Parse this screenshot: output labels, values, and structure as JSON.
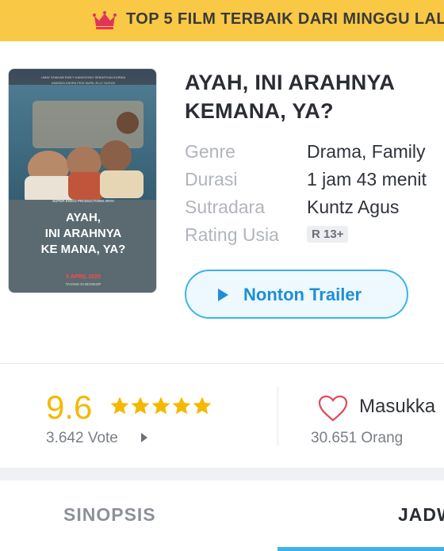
{
  "banner": {
    "text": "TOP 5 FILM TERBAIK DARI MINGGU LAL",
    "icon": "crown-icon"
  },
  "movie": {
    "title": "AYAH, INI ARAHNYA KEMANA, YA?",
    "poster": {
      "credits_line": "UMAY SHAHAB   RIZKY HANGGONO   SEBASTIAN KURNIA",
      "credits_line2": "AMANDA ZAHRA   FEDI NURIL   ELLY SUGIGI",
      "studio_line": "SUPER ERIKO   PRODUCTIONS   ARYA",
      "title_line1": "AYAH,",
      "title_line2": "INI ARAHNYA",
      "title_line3": "KE MANA, YA?",
      "release_line": "9 APRIL 2025",
      "footer_line": "TAYANG DI BIOSKOP"
    },
    "info": [
      {
        "label": "Genre",
        "value": "Drama, Family"
      },
      {
        "label": "Durasi",
        "value": "1 jam 43 menit"
      },
      {
        "label": "Sutradara",
        "value": "Kuntz Agus"
      },
      {
        "label": "Rating Usia",
        "value": "R 13+"
      }
    ],
    "trailer_button": "Nonton Trailer"
  },
  "rating": {
    "score": "9.6",
    "stars": 5,
    "votes": "3.642 Vote",
    "star_color": "#f5b800"
  },
  "favorite": {
    "label": "Masukka",
    "count": "30.651 Orang",
    "icon": "heart-icon"
  },
  "tabs": [
    {
      "label": "SINOPSIS",
      "active": false
    },
    {
      "label": "JADW",
      "active": true
    }
  ],
  "colors": {
    "banner_bg": "#f9c845",
    "accent": "#3db3e8",
    "accent_text": "#1d8fd6",
    "rating": "#f5b800"
  }
}
